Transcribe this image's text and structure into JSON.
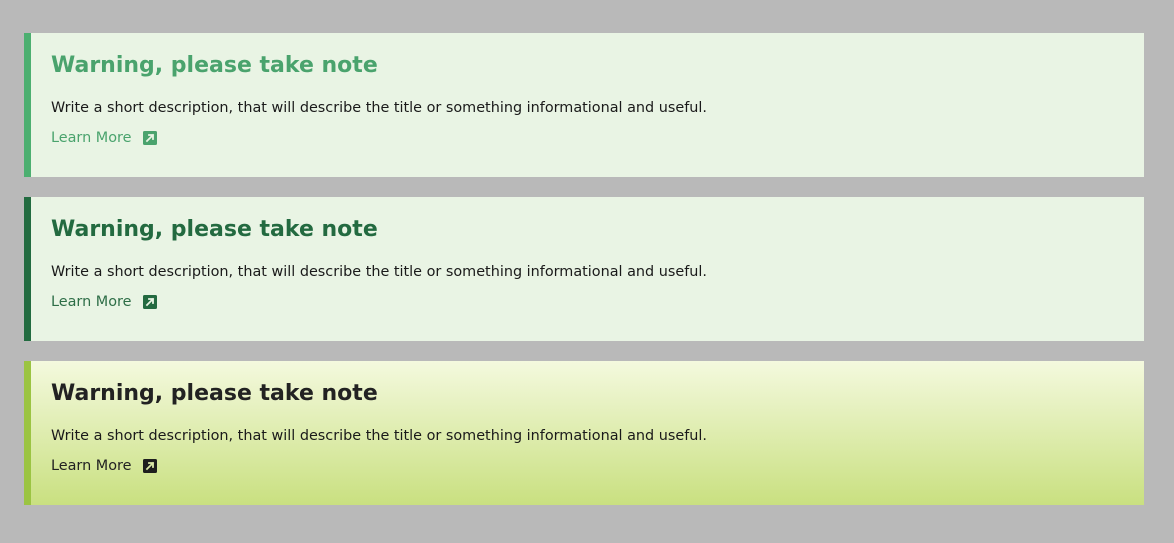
{
  "alerts": [
    {
      "title": "Warning, please take note",
      "description": "Write a short description, that will describe the title or something informational and useful.",
      "link_label": "Learn More",
      "link_icon": "external-link-icon",
      "accent_color": "#4caf70",
      "background_color": "#e9f4e4"
    },
    {
      "title": "Warning, please take note",
      "description": "Write a short description, that will describe the title or something informational and useful.",
      "link_label": "Learn More",
      "link_icon": "external-link-icon",
      "accent_color": "#226b40",
      "background_color": "#e9f4e4"
    },
    {
      "title": "Warning, please take note",
      "description": "Write a short description, that will describe the title or something informational and useful.",
      "link_label": "Learn More",
      "link_icon": "external-link-icon",
      "accent_color": "#9bc442",
      "background_color": "#f4f9de"
    }
  ]
}
